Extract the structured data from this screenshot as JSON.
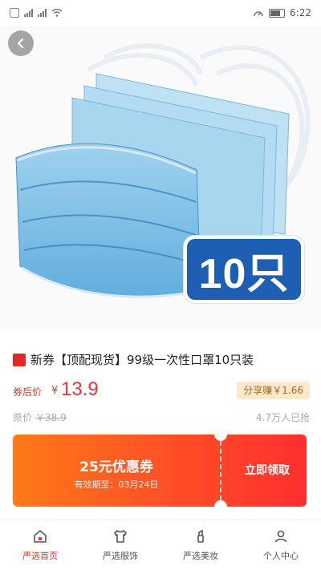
{
  "status": {
    "time": "6:22"
  },
  "hero": {
    "badge": "10只"
  },
  "product": {
    "title": "新券【顶配现货】99级一次性口罩10只装",
    "price_label": "券后价",
    "currency": "¥",
    "price": "13.9",
    "share_text": "分享赚￥1.66",
    "orig_label": "原价",
    "orig_price": "￥38.9",
    "sold": "4.7万人已抢"
  },
  "coupon": {
    "amount": "25元优惠券",
    "expiry": "有效期至：03月24日",
    "claim": "立即领取"
  },
  "tabs": [
    {
      "label": "严选首页",
      "icon": "home-icon"
    },
    {
      "label": "严选服饰",
      "icon": "shirt-icon"
    },
    {
      "label": "严选美妆",
      "icon": "makeup-icon"
    },
    {
      "label": "个人中心",
      "icon": "user-icon"
    }
  ],
  "colors": {
    "accent": "#e33333",
    "coupon_start": "#ff7a18",
    "coupon_end": "#ff2f2f",
    "badge_blue": "#1f5fb3"
  }
}
